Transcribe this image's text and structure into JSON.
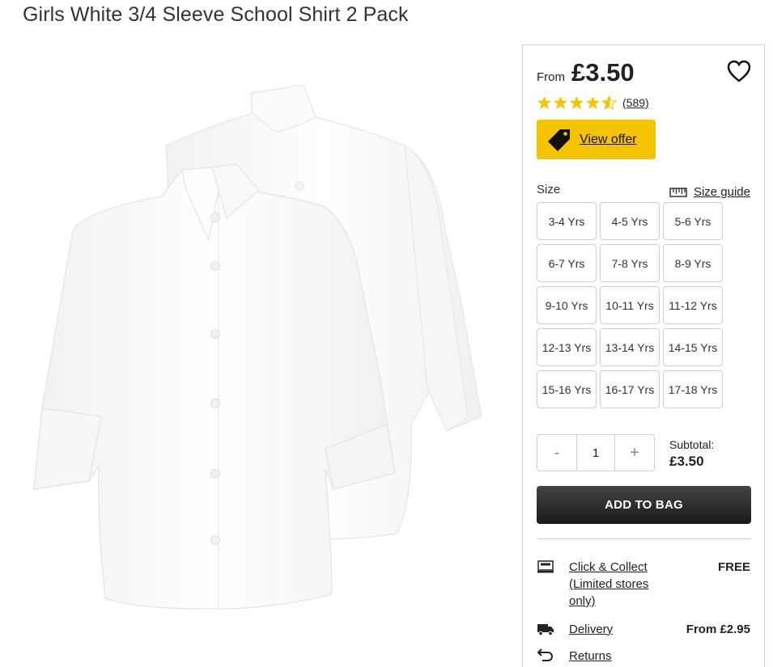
{
  "product": {
    "title": "Girls White 3/4 Sleeve School Shirt 2 Pack",
    "price_prefix": "From",
    "price": "£3.50",
    "rating": 4.5,
    "review_count": "(589)"
  },
  "offer": {
    "label": "View offer",
    "icon": "price-tag-icon"
  },
  "sizes": {
    "label": "Size",
    "guide_label": "Size guide",
    "options": [
      "3-4 Yrs",
      "4-5 Yrs",
      "5-6 Yrs",
      "6-7 Yrs",
      "7-8 Yrs",
      "8-9 Yrs",
      "9-10 Yrs",
      "10-11 Yrs",
      "11-12 Yrs",
      "12-13 Yrs",
      "13-14 Yrs",
      "14-15 Yrs",
      "15-16 Yrs",
      "16-17 Yrs",
      "17-18 Yrs"
    ]
  },
  "quantity": {
    "minus": "-",
    "value": "1",
    "plus": "+"
  },
  "subtotal": {
    "label": "Subtotal:",
    "value": "£3.50"
  },
  "cart": {
    "add_label": "ADD TO BAG"
  },
  "fulfilment": [
    {
      "icon": "click-collect-icon",
      "label": "Click & Collect (Limited stores only)",
      "price": "FREE"
    },
    {
      "icon": "delivery-truck-icon",
      "label": "Delivery",
      "price": "From £2.95"
    },
    {
      "icon": "returns-icon",
      "label": "Returns",
      "price": ""
    }
  ],
  "colors": {
    "accent": "#f5c400",
    "star": "#f5c400",
    "primary_button": "#222222"
  }
}
